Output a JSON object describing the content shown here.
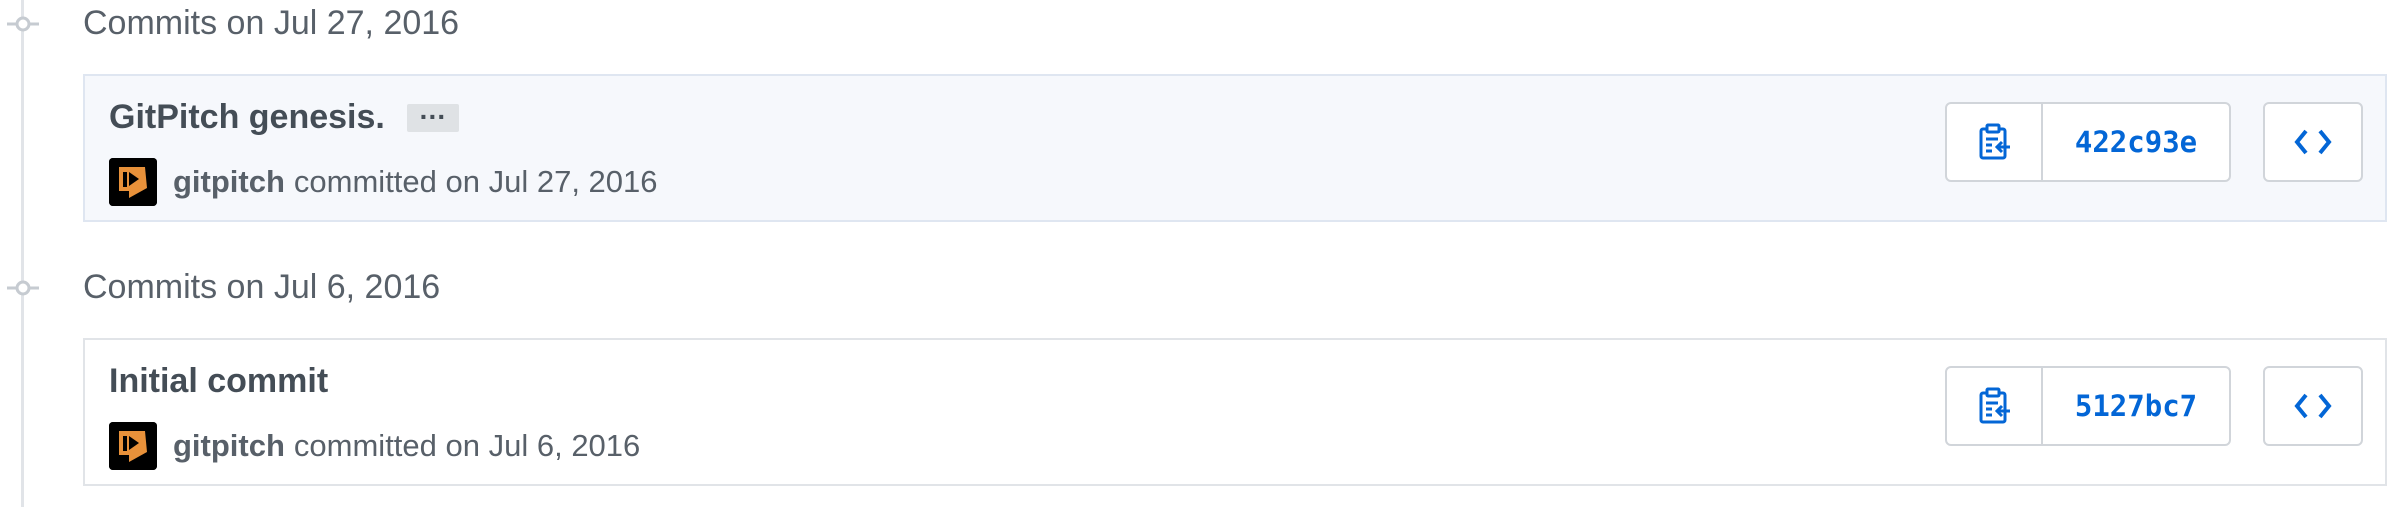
{
  "colors": {
    "link_blue": "#0366d6",
    "timeline_gray": "#e1e4e8",
    "highlight_bg": "#f6f8fc",
    "avatar_orange": "#e8913a"
  },
  "groups": [
    {
      "title": "Commits on Jul 27, 2016",
      "commit": {
        "message": "GitPitch genesis.",
        "ellipsis_label": "…",
        "author": "gitpitch",
        "action_text": "committed on Jul 27, 2016",
        "sha": "422c93e",
        "copy_icon": "clippy-icon",
        "browse_icon": "code-icon"
      }
    },
    {
      "title": "Commits on Jul 6, 2016",
      "commit": {
        "message": "Initial commit",
        "author": "gitpitch",
        "action_text": "committed on Jul 6, 2016",
        "sha": "5127bc7",
        "copy_icon": "clippy-icon",
        "browse_icon": "code-icon"
      }
    }
  ]
}
